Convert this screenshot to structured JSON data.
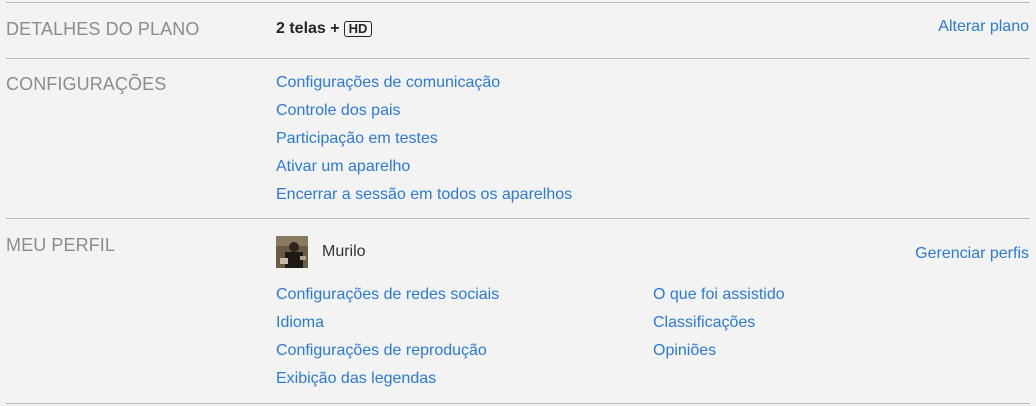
{
  "plan": {
    "section_title": "DETALHES DO PLANO",
    "plan_text": "2 telas +",
    "hd_badge": "HD",
    "change_link": "Alterar plano"
  },
  "settings": {
    "section_title": "CONFIGURAÇÕES",
    "links": [
      "Configurações de comunicação",
      "Controle dos pais",
      "Participação em testes",
      "Ativar um aparelho",
      "Encerrar a sessão em todos os aparelhos"
    ]
  },
  "profile": {
    "section_title": "MEU PERFIL",
    "name": "Murilo",
    "manage_link": "Gerenciar perfis",
    "left_links": [
      "Configurações de redes sociais",
      "Idioma",
      "Configurações de reprodução",
      "Exibição das legendas"
    ],
    "right_links": [
      "O que foi assistido",
      "Classificações",
      "Opiniões"
    ]
  }
}
